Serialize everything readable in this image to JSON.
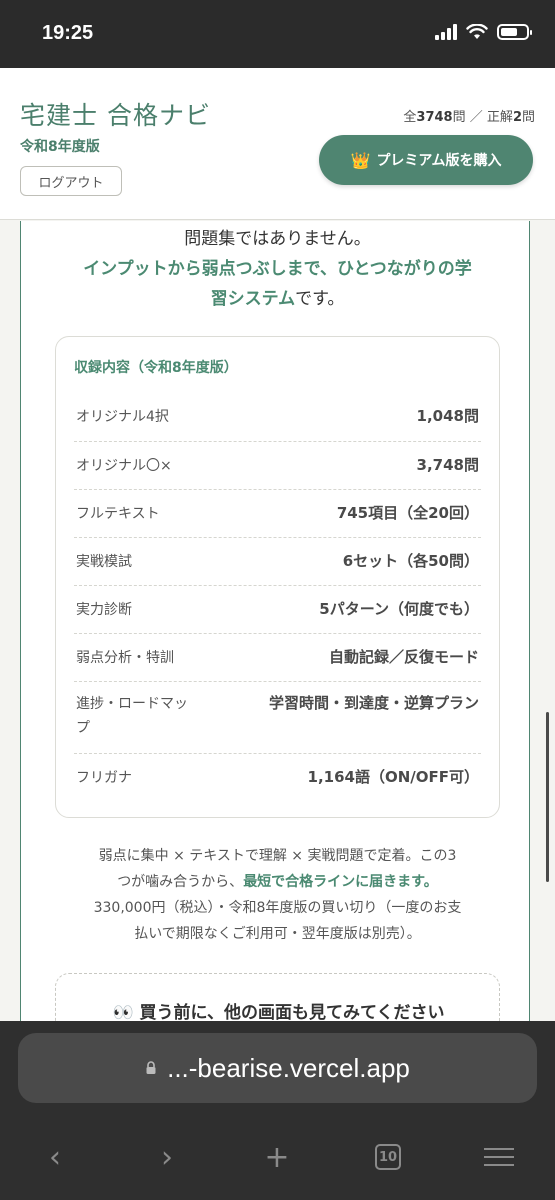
{
  "status_bar": {
    "time": "19:25"
  },
  "header": {
    "title": "宅建士 合格ナビ",
    "edition": "令和8年度版",
    "logout_label": "ログアウト",
    "counts": {
      "prefix_total": "全",
      "total": "3748",
      "unit_total": "問",
      "separator": "／",
      "prefix_correct": "正解",
      "correct": "2",
      "unit_correct": "問"
    },
    "premium_icon": "👑",
    "premium_label": "プレミアム版を購入"
  },
  "intro": {
    "line1": "問題集ではありません。",
    "line2_green": "インプットから弱点つぶしまで、ひとつながりの学",
    "line3_green": "習システム",
    "line3_rest": "です。"
  },
  "contents_table": {
    "title": "収録内容（令和8年度版）",
    "rows": [
      {
        "label": "オリジナル4択",
        "value": "1,048問"
      },
      {
        "label": "オリジナル〇×",
        "value": "3,748問"
      },
      {
        "label": "フルテキスト",
        "value": "745項目（全20回）"
      },
      {
        "label": "実戦模試",
        "value": "6セット（各50問）"
      },
      {
        "label": "実力診断",
        "value": "5パターン（何度でも）"
      },
      {
        "label": "弱点分析・特訓",
        "value": "自動記録／反復モード"
      },
      {
        "label_line1": "進捗・ロードマッ",
        "label_line2": "プ",
        "value": "学習時間・到達度・逆算プラン"
      },
      {
        "label": "フリガナ",
        "value": "1,164語（ON/OFF可）"
      }
    ]
  },
  "summary": {
    "line1": "弱点に集中 × テキストで理解 × 実戦問題で定着。この3",
    "line2_pre": "つが噛み合うから、",
    "line2_em": "最短で合格ラインに届きます。",
    "line3": "330,000円（税込）・令和8年度版の買い切り（一度のお支",
    "line4": "払いで期限なくご利用可・翌年度版は別売）。"
  },
  "more_section": {
    "icon": "👀",
    "title": "買う前に、他の画面も見てみてください"
  },
  "browser": {
    "url": "...-bearise.vercel.app",
    "tabs_count": "10",
    "back_glyph": "‹",
    "forward_glyph": "›",
    "new_tab_glyph": "+"
  }
}
